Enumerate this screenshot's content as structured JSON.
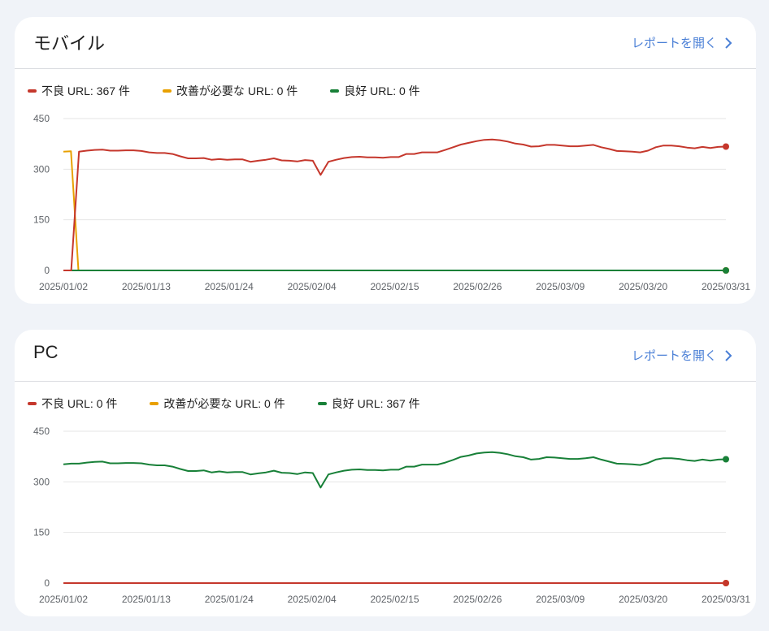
{
  "colors": {
    "poor": "#c5372c",
    "needs_improvement": "#e8a000",
    "good": "#188038",
    "link": "#4a7fd6",
    "grid": "#e6e6e6"
  },
  "cards": [
    {
      "title": "モバイル",
      "open_report": "レポートを開く",
      "legend": [
        {
          "label": "不良 URL: 367 件",
          "color_key": "poor"
        },
        {
          "label": "改善が必要な URL: 0 件",
          "color_key": "needs_improvement"
        },
        {
          "label": "良好 URL: 0 件",
          "color_key": "good"
        }
      ]
    },
    {
      "title": "PC",
      "open_report": "レポートを開く",
      "legend": [
        {
          "label": "不良 URL: 0 件",
          "color_key": "poor"
        },
        {
          "label": "改善が必要な URL: 0 件",
          "color_key": "needs_improvement"
        },
        {
          "label": "良好 URL: 367 件",
          "color_key": "good"
        }
      ]
    }
  ],
  "chart_data": [
    {
      "type": "line",
      "title": "モバイル",
      "x_ticks": [
        "2025/01/02",
        "2025/01/13",
        "2025/01/24",
        "2025/02/04",
        "2025/02/15",
        "2025/02/26",
        "2025/03/09",
        "2025/03/20",
        "2025/03/31"
      ],
      "y_ticks": [
        0,
        150,
        300,
        450
      ],
      "ylim": [
        0,
        450
      ],
      "x_range": [
        "2025/01/02",
        "2025/03/31"
      ],
      "grid": true,
      "series": [
        {
          "name": "不良 URL",
          "color_key": "poor",
          "values": [
            0,
            0,
            0,
            0,
            0,
            0,
            0,
            0,
            0,
            0,
            0,
            0,
            0,
            0,
            0,
            0,
            0,
            0,
            0,
            0,
            0,
            0,
            0,
            0,
            0,
            0,
            0,
            0,
            0,
            0,
            0,
            0,
            0,
            0,
            0,
            0,
            0,
            0,
            0,
            0,
            0,
            0,
            0,
            0,
            0,
            0,
            0,
            0,
            0,
            0,
            0,
            0,
            0,
            0,
            0,
            0,
            0,
            0,
            0,
            0,
            0,
            0,
            0,
            0,
            0,
            0,
            0,
            0,
            0,
            0,
            0,
            0,
            0,
            0,
            0,
            0,
            0,
            0,
            0,
            0,
            0,
            0,
            0,
            0,
            0,
            0,
            0,
            0,
            0
          ]
        },
        {
          "name": "改善が必要な URL",
          "color_key": "needs_improvement",
          "values": [
            352,
            353,
            0,
            0,
            0,
            0,
            0,
            0,
            0,
            0,
            0,
            0,
            0,
            0,
            0,
            0,
            0,
            0,
            0,
            0,
            0,
            0,
            0,
            0,
            0,
            0,
            0,
            0,
            0,
            0,
            0,
            0,
            0,
            0,
            0,
            0,
            0,
            0,
            0,
            0,
            0,
            0,
            0,
            0,
            0,
            0,
            0,
            0,
            0,
            0,
            0,
            0,
            0,
            0,
            0,
            0,
            0,
            0,
            0,
            0,
            0,
            0,
            0,
            0,
            0,
            0,
            0,
            0,
            0,
            0,
            0,
            0,
            0,
            0,
            0,
            0,
            0,
            0,
            0,
            0,
            0,
            0,
            0,
            0,
            0,
            0,
            0,
            0,
            0
          ]
        },
        {
          "name": "良好 URL",
          "color_key": "good",
          "values": [
            0,
            0,
            0,
            0,
            0,
            0,
            0,
            0,
            0,
            0,
            0,
            0,
            0,
            0,
            0,
            0,
            0,
            0,
            0,
            0,
            0,
            0,
            0,
            0,
            0,
            0,
            0,
            0,
            0,
            0,
            0,
            0,
            0,
            0,
            0,
            0,
            0,
            0,
            0,
            0,
            0,
            0,
            0,
            0,
            0,
            0,
            0,
            0,
            0,
            0,
            0,
            0,
            0,
            0,
            0,
            0,
            0,
            0,
            0,
            0,
            0,
            0,
            0,
            0,
            0,
            0,
            0,
            0,
            0,
            0,
            0,
            0,
            0,
            0,
            0,
            0,
            0,
            0,
            0,
            0,
            0,
            0,
            0,
            0,
            0,
            0,
            0,
            0,
            0
          ]
        },
        {
          "name": "不良 URL",
          "color_key": "poor",
          "values": [
            0,
            0,
            352,
            355,
            357,
            358,
            355,
            355,
            356,
            356,
            354,
            350,
            348,
            348,
            345,
            338,
            332,
            332,
            333,
            328,
            330,
            328,
            329,
            329,
            322,
            325,
            328,
            332,
            326,
            325,
            323,
            327,
            325,
            283,
            322,
            328,
            333,
            336,
            337,
            335,
            335,
            334,
            336,
            336,
            345,
            345,
            350,
            350,
            350,
            357,
            365,
            373,
            378,
            383,
            387,
            388,
            386,
            382,
            376,
            373,
            367,
            368,
            372,
            372,
            370,
            368,
            368,
            370,
            372,
            365,
            360,
            354,
            353,
            352,
            350,
            355,
            365,
            370,
            370,
            368,
            364,
            362,
            366,
            363,
            366,
            367
          ]
        }
      ]
    },
    {
      "type": "line",
      "title": "PC",
      "x_ticks": [
        "2025/01/02",
        "2025/01/13",
        "2025/01/24",
        "2025/02/04",
        "2025/02/15",
        "2025/02/26",
        "2025/03/09",
        "2025/03/20",
        "2025/03/31"
      ],
      "y_ticks": [
        0,
        150,
        300,
        450
      ],
      "ylim": [
        0,
        450
      ],
      "x_range": [
        "2025/01/02",
        "2025/03/31"
      ],
      "grid": true,
      "series": [
        {
          "name": "良好 URL",
          "color_key": "good",
          "values": [
            352,
            354,
            354,
            357,
            359,
            360,
            355,
            355,
            356,
            356,
            355,
            351,
            349,
            349,
            345,
            338,
            332,
            332,
            334,
            328,
            331,
            328,
            329,
            329,
            322,
            325,
            328,
            333,
            327,
            326,
            323,
            328,
            326,
            283,
            322,
            328,
            333,
            336,
            337,
            335,
            335,
            334,
            336,
            336,
            345,
            345,
            351,
            351,
            351,
            357,
            365,
            374,
            378,
            384,
            387,
            388,
            386,
            382,
            376,
            373,
            366,
            368,
            373,
            372,
            370,
            368,
            368,
            370,
            373,
            366,
            360,
            354,
            353,
            352,
            350,
            356,
            366,
            370,
            370,
            368,
            364,
            362,
            366,
            363,
            366,
            367
          ]
        },
        {
          "name": "改善が必要な URL",
          "color_key": "needs_improvement",
          "values": [
            0,
            0,
            0,
            0,
            0,
            0,
            0,
            0,
            0,
            0,
            0,
            0,
            0,
            0,
            0,
            0,
            0,
            0,
            0,
            0,
            0,
            0,
            0,
            0,
            0,
            0,
            0,
            0,
            0,
            0,
            0,
            0,
            0,
            0,
            0,
            0,
            0,
            0,
            0,
            0,
            0,
            0,
            0,
            0,
            0,
            0,
            0,
            0,
            0,
            0,
            0,
            0,
            0,
            0,
            0,
            0,
            0,
            0,
            0,
            0,
            0,
            0,
            0,
            0,
            0,
            0,
            0,
            0,
            0,
            0,
            0,
            0,
            0,
            0,
            0,
            0,
            0,
            0,
            0,
            0,
            0,
            0,
            0,
            0,
            0,
            0,
            0,
            0,
            0
          ]
        },
        {
          "name": "不良 URL",
          "color_key": "poor",
          "values": [
            0,
            0,
            0,
            0,
            0,
            0,
            0,
            0,
            0,
            0,
            0,
            0,
            0,
            0,
            0,
            0,
            0,
            0,
            0,
            0,
            0,
            0,
            0,
            0,
            0,
            0,
            0,
            0,
            0,
            0,
            0,
            0,
            0,
            0,
            0,
            0,
            0,
            0,
            0,
            0,
            0,
            0,
            0,
            0,
            0,
            0,
            0,
            0,
            0,
            0,
            0,
            0,
            0,
            0,
            0,
            0,
            0,
            0,
            0,
            0,
            0,
            0,
            0,
            0,
            0,
            0,
            0,
            0,
            0,
            0,
            0,
            0,
            0,
            0,
            0,
            0,
            0,
            0,
            0,
            0,
            0,
            0,
            0,
            0,
            0,
            0,
            0,
            0,
            0
          ]
        }
      ]
    }
  ]
}
